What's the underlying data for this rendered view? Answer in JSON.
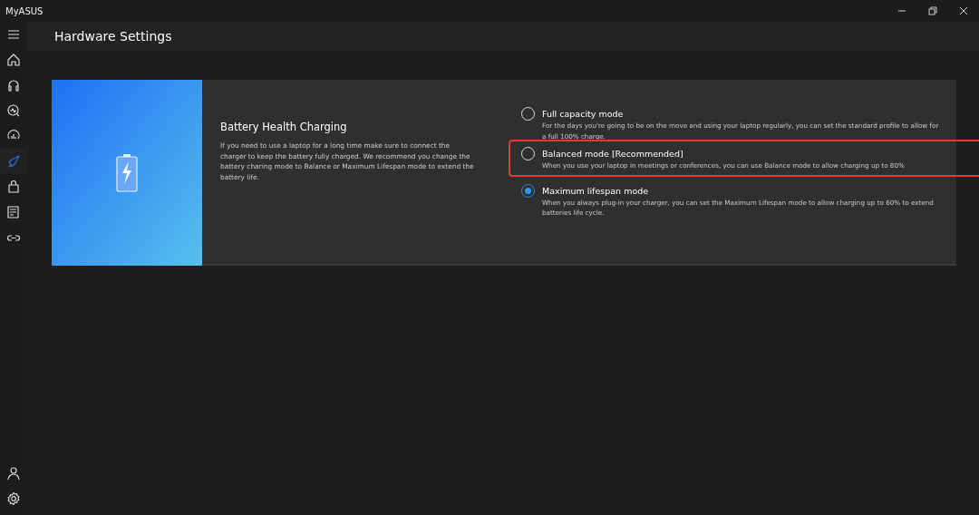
{
  "window": {
    "title": "MyASUS"
  },
  "sidebar": {
    "items": [
      {
        "selected": false
      },
      {
        "selected": false
      },
      {
        "selected": false
      },
      {
        "selected": false
      },
      {
        "selected": true
      },
      {
        "selected": false
      },
      {
        "selected": false
      },
      {
        "selected": false
      }
    ],
    "bottom_items": [
      {
        "selected": false
      },
      {
        "selected": false
      }
    ]
  },
  "page": {
    "title": "Hardware Settings"
  },
  "section": {
    "title": "Battery Health Charging",
    "description": "If you need to use a laptop for a long time make sure to connect the charger to keep the battery fully charged. We recommend you change the battery charing mode to Balance or Maximum Lifespan mode to extend the battery life.",
    "options": [
      {
        "label": "Full capacity mode",
        "description": "For the days you're going to be on the move and using your laptop regularly, you can set the standard profile to allow for a full 100% charge.",
        "selected": false,
        "highlighted": false
      },
      {
        "label": "Balanced mode [Recommended]",
        "description": "When you use your laptop in meetings or conferences, you can use Balance mode to allow charging up to 80%",
        "selected": false,
        "highlighted": true
      },
      {
        "label": "Maximum lifespan mode",
        "description": "When you always plug-in your charger, you can set the Maximum Lifespan mode to allow charging up to 60% to extend batteries life cycle.",
        "selected": true,
        "highlighted": false
      }
    ]
  }
}
